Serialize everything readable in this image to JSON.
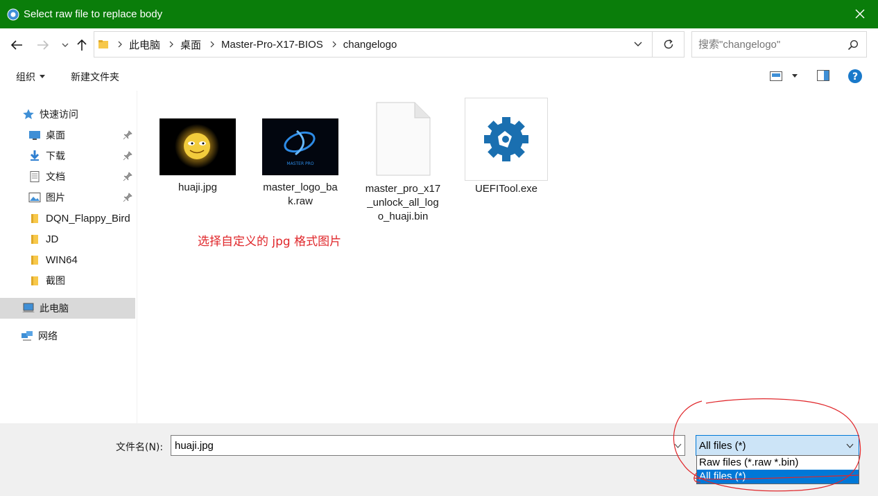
{
  "window": {
    "title": "Select raw file to replace body"
  },
  "address_bar": {
    "breadcrumbs": [
      "此电脑",
      "桌面",
      "Master-Pro-X17-BIOS",
      "changelogo"
    ],
    "search_placeholder": "搜索\"changelogo\""
  },
  "toolbar": {
    "organize": "组织",
    "new_folder": "新建文件夹"
  },
  "sidebar": {
    "quick_access": "快速访问",
    "items": [
      {
        "label": "桌面",
        "icon": "desktop-icon",
        "pinned": true
      },
      {
        "label": "下载",
        "icon": "download-icon",
        "pinned": true
      },
      {
        "label": "文档",
        "icon": "document-icon",
        "pinned": true
      },
      {
        "label": "图片",
        "icon": "pictures-icon",
        "pinned": true
      },
      {
        "label": "DQN_Flappy_Bird",
        "icon": "folder-icon",
        "pinned": false
      },
      {
        "label": "JD",
        "icon": "folder-icon",
        "pinned": false
      },
      {
        "label": "WIN64",
        "icon": "folder-icon",
        "pinned": false
      },
      {
        "label": "截图",
        "icon": "folder-icon",
        "pinned": false
      }
    ],
    "this_pc": "此电脑",
    "network": "网络"
  },
  "files": [
    {
      "name_line1": "huaji.jpg",
      "name_line2": "",
      "name_line3": "",
      "type": "image-jpg"
    },
    {
      "name_line1": "master_logo_ba",
      "name_line2": "k.raw",
      "name_line3": "",
      "type": "image-raw",
      "thumb_text": "MASTER PRO"
    },
    {
      "name_line1": "master_pro_x17",
      "name_line2": "_unlock_all_log",
      "name_line3": "o_huaji.bin",
      "type": "blank-file"
    },
    {
      "name_line1": "UEFITool.exe",
      "name_line2": "",
      "name_line3": "",
      "type": "exe"
    }
  ],
  "annotation": "选择自定义的 jpg 格式图片",
  "bottom_bar": {
    "filename_label": "文件名(N):",
    "filename_value": "huaji.jpg",
    "file_type_selected": "All files  (*)",
    "file_type_options": [
      "Raw files (*.raw *.bin)",
      "All files  (*)"
    ]
  },
  "colors": {
    "titlebar": "#0a7d0a",
    "accent": "#0078d7",
    "annotation": "#e0272b"
  }
}
